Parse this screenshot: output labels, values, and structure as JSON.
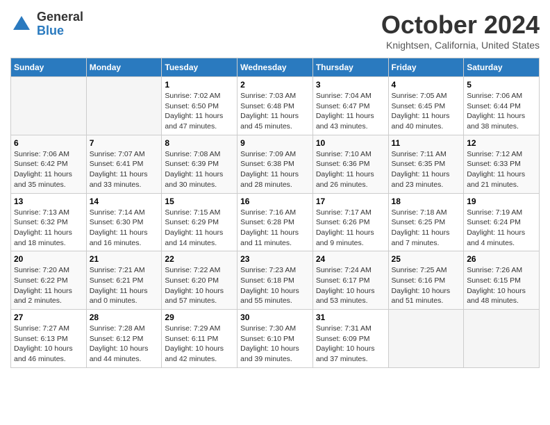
{
  "logo": {
    "general": "General",
    "blue": "Blue"
  },
  "title": "October 2024",
  "location": "Knightsen, California, United States",
  "headers": [
    "Sunday",
    "Monday",
    "Tuesday",
    "Wednesday",
    "Thursday",
    "Friday",
    "Saturday"
  ],
  "weeks": [
    [
      {
        "day": "",
        "info": ""
      },
      {
        "day": "",
        "info": ""
      },
      {
        "day": "1",
        "info": "Sunrise: 7:02 AM\nSunset: 6:50 PM\nDaylight: 11 hours and 47 minutes."
      },
      {
        "day": "2",
        "info": "Sunrise: 7:03 AM\nSunset: 6:48 PM\nDaylight: 11 hours and 45 minutes."
      },
      {
        "day": "3",
        "info": "Sunrise: 7:04 AM\nSunset: 6:47 PM\nDaylight: 11 hours and 43 minutes."
      },
      {
        "day": "4",
        "info": "Sunrise: 7:05 AM\nSunset: 6:45 PM\nDaylight: 11 hours and 40 minutes."
      },
      {
        "day": "5",
        "info": "Sunrise: 7:06 AM\nSunset: 6:44 PM\nDaylight: 11 hours and 38 minutes."
      }
    ],
    [
      {
        "day": "6",
        "info": "Sunrise: 7:06 AM\nSunset: 6:42 PM\nDaylight: 11 hours and 35 minutes."
      },
      {
        "day": "7",
        "info": "Sunrise: 7:07 AM\nSunset: 6:41 PM\nDaylight: 11 hours and 33 minutes."
      },
      {
        "day": "8",
        "info": "Sunrise: 7:08 AM\nSunset: 6:39 PM\nDaylight: 11 hours and 30 minutes."
      },
      {
        "day": "9",
        "info": "Sunrise: 7:09 AM\nSunset: 6:38 PM\nDaylight: 11 hours and 28 minutes."
      },
      {
        "day": "10",
        "info": "Sunrise: 7:10 AM\nSunset: 6:36 PM\nDaylight: 11 hours and 26 minutes."
      },
      {
        "day": "11",
        "info": "Sunrise: 7:11 AM\nSunset: 6:35 PM\nDaylight: 11 hours and 23 minutes."
      },
      {
        "day": "12",
        "info": "Sunrise: 7:12 AM\nSunset: 6:33 PM\nDaylight: 11 hours and 21 minutes."
      }
    ],
    [
      {
        "day": "13",
        "info": "Sunrise: 7:13 AM\nSunset: 6:32 PM\nDaylight: 11 hours and 18 minutes."
      },
      {
        "day": "14",
        "info": "Sunrise: 7:14 AM\nSunset: 6:30 PM\nDaylight: 11 hours and 16 minutes."
      },
      {
        "day": "15",
        "info": "Sunrise: 7:15 AM\nSunset: 6:29 PM\nDaylight: 11 hours and 14 minutes."
      },
      {
        "day": "16",
        "info": "Sunrise: 7:16 AM\nSunset: 6:28 PM\nDaylight: 11 hours and 11 minutes."
      },
      {
        "day": "17",
        "info": "Sunrise: 7:17 AM\nSunset: 6:26 PM\nDaylight: 11 hours and 9 minutes."
      },
      {
        "day": "18",
        "info": "Sunrise: 7:18 AM\nSunset: 6:25 PM\nDaylight: 11 hours and 7 minutes."
      },
      {
        "day": "19",
        "info": "Sunrise: 7:19 AM\nSunset: 6:24 PM\nDaylight: 11 hours and 4 minutes."
      }
    ],
    [
      {
        "day": "20",
        "info": "Sunrise: 7:20 AM\nSunset: 6:22 PM\nDaylight: 11 hours and 2 minutes."
      },
      {
        "day": "21",
        "info": "Sunrise: 7:21 AM\nSunset: 6:21 PM\nDaylight: 11 hours and 0 minutes."
      },
      {
        "day": "22",
        "info": "Sunrise: 7:22 AM\nSunset: 6:20 PM\nDaylight: 10 hours and 57 minutes."
      },
      {
        "day": "23",
        "info": "Sunrise: 7:23 AM\nSunset: 6:18 PM\nDaylight: 10 hours and 55 minutes."
      },
      {
        "day": "24",
        "info": "Sunrise: 7:24 AM\nSunset: 6:17 PM\nDaylight: 10 hours and 53 minutes."
      },
      {
        "day": "25",
        "info": "Sunrise: 7:25 AM\nSunset: 6:16 PM\nDaylight: 10 hours and 51 minutes."
      },
      {
        "day": "26",
        "info": "Sunrise: 7:26 AM\nSunset: 6:15 PM\nDaylight: 10 hours and 48 minutes."
      }
    ],
    [
      {
        "day": "27",
        "info": "Sunrise: 7:27 AM\nSunset: 6:13 PM\nDaylight: 10 hours and 46 minutes."
      },
      {
        "day": "28",
        "info": "Sunrise: 7:28 AM\nSunset: 6:12 PM\nDaylight: 10 hours and 44 minutes."
      },
      {
        "day": "29",
        "info": "Sunrise: 7:29 AM\nSunset: 6:11 PM\nDaylight: 10 hours and 42 minutes."
      },
      {
        "day": "30",
        "info": "Sunrise: 7:30 AM\nSunset: 6:10 PM\nDaylight: 10 hours and 39 minutes."
      },
      {
        "day": "31",
        "info": "Sunrise: 7:31 AM\nSunset: 6:09 PM\nDaylight: 10 hours and 37 minutes."
      },
      {
        "day": "",
        "info": ""
      },
      {
        "day": "",
        "info": ""
      }
    ]
  ]
}
